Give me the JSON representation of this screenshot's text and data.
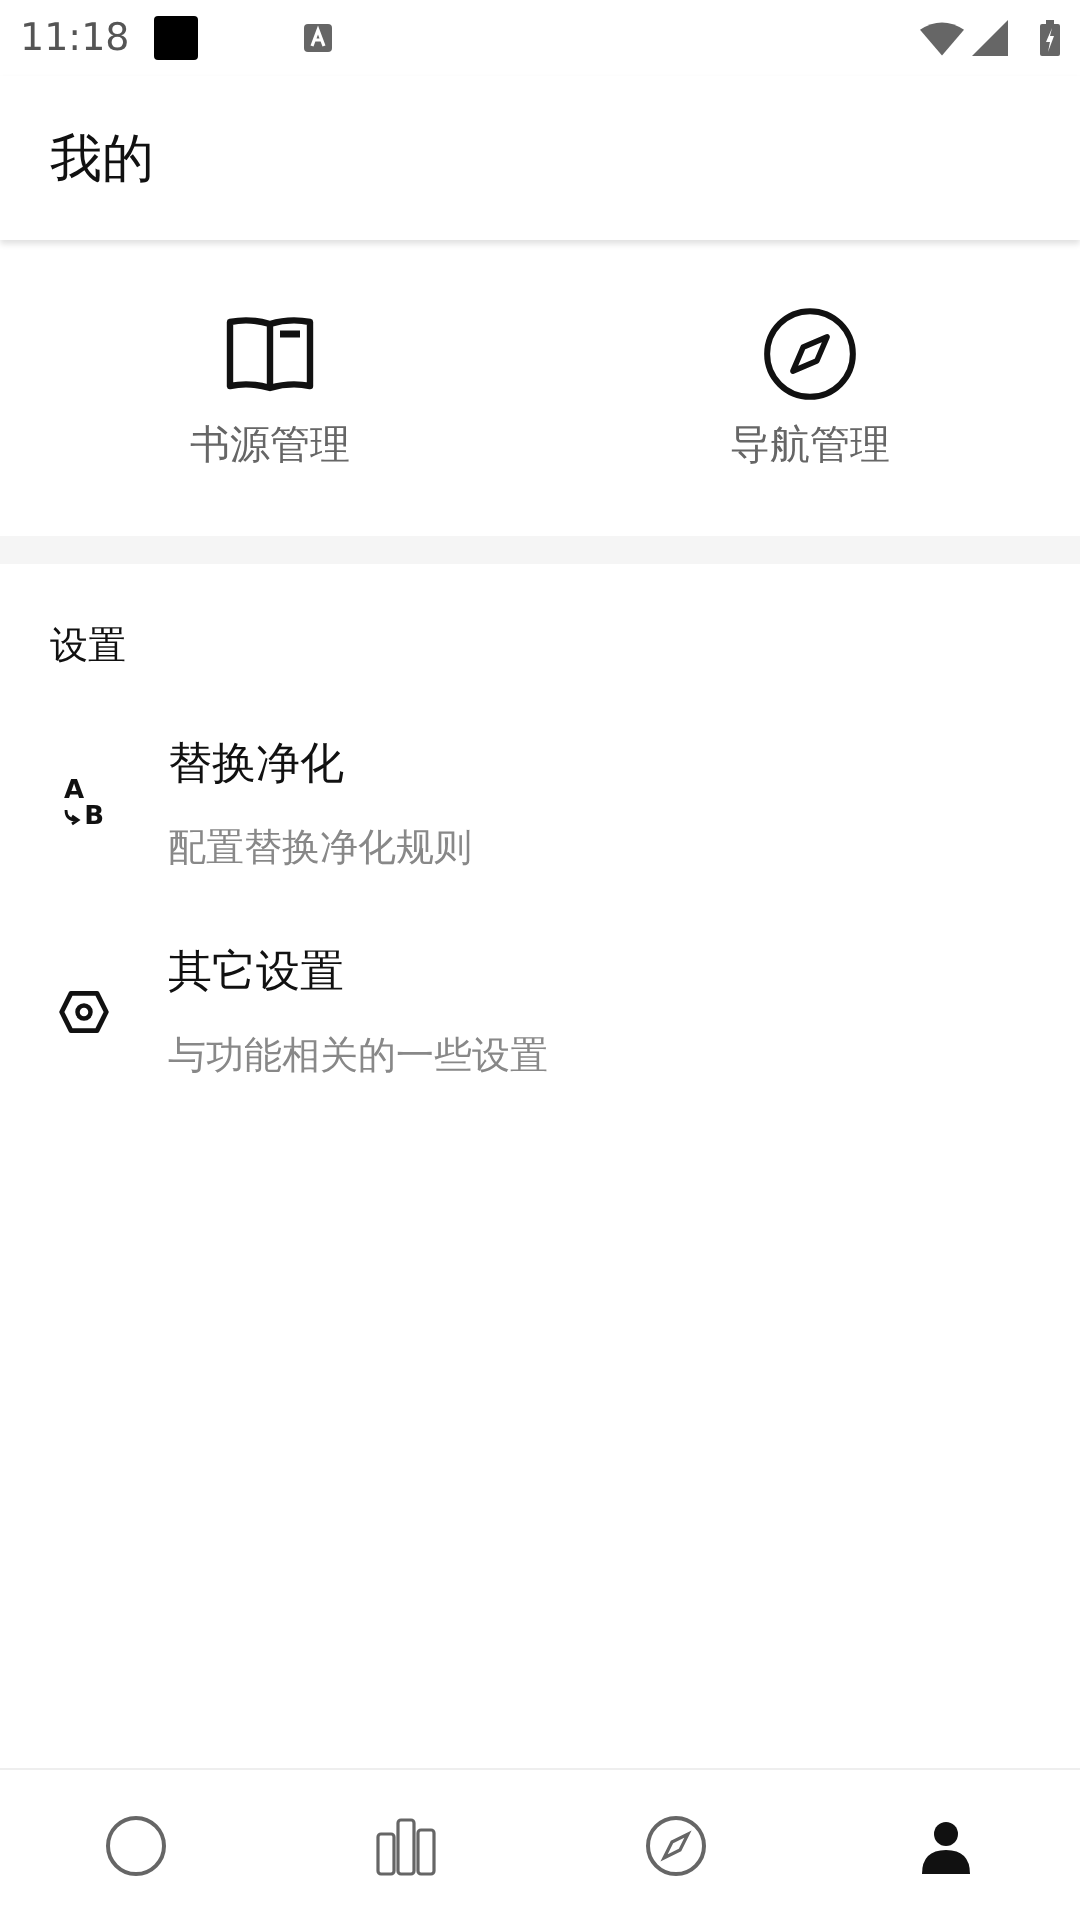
{
  "status_bar": {
    "time": "11:18"
  },
  "header": {
    "title": "我的"
  },
  "shortcuts": [
    {
      "kind": "book",
      "label": "书源管理"
    },
    {
      "kind": "compass",
      "label": "导航管理"
    }
  ],
  "settings": {
    "heading": "设置",
    "items": [
      {
        "kind": "replace",
        "icon_letters": [
          "A",
          "B"
        ],
        "title": "替换净化",
        "subtitle": "配置替换净化规则"
      },
      {
        "kind": "hexagon",
        "title": "其它设置",
        "subtitle": "与功能相关的一些设置"
      }
    ]
  },
  "bottom_nav": [
    {
      "kind": "circle",
      "selected": false
    },
    {
      "kind": "books",
      "selected": false
    },
    {
      "kind": "compass",
      "selected": false
    },
    {
      "kind": "person",
      "selected": true
    }
  ]
}
